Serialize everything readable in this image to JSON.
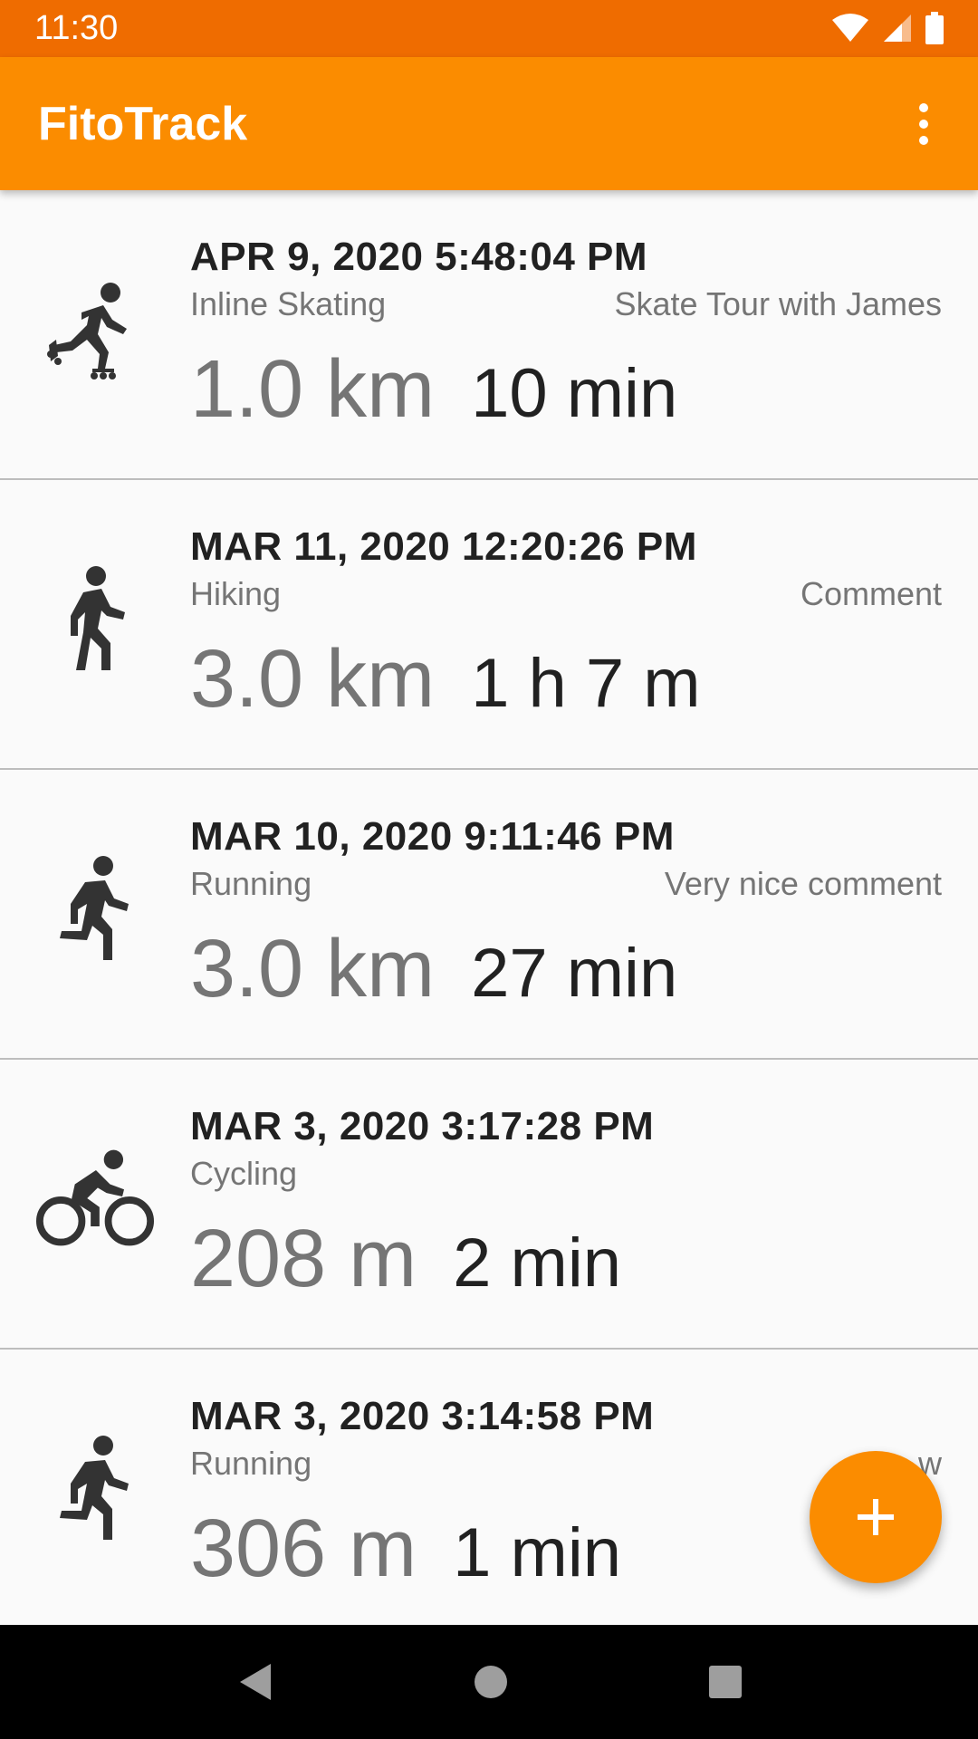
{
  "status_bar": {
    "time": "11:30"
  },
  "app_bar": {
    "title": "FitoTrack"
  },
  "workouts": [
    {
      "date": "APR 9, 2020 5:48:04 PM",
      "type": "Inline Skating",
      "comment": "Skate Tour with James",
      "distance": "1.0 km",
      "duration": "10 min",
      "icon": "inline-skating-icon"
    },
    {
      "date": "MAR 11, 2020 12:20:26 PM",
      "type": "Hiking",
      "comment": "Comment",
      "distance": "3.0 km",
      "duration": "1 h 7 m",
      "icon": "hiking-icon"
    },
    {
      "date": "MAR 10, 2020 9:11:46 PM",
      "type": "Running",
      "comment": "Very nice comment",
      "distance": "3.0 km",
      "duration": "27 min",
      "icon": "running-icon"
    },
    {
      "date": "MAR 3, 2020 3:17:28 PM",
      "type": "Cycling",
      "comment": "",
      "distance": "208 m",
      "duration": "2 min",
      "icon": "cycling-icon"
    },
    {
      "date": "MAR 3, 2020 3:14:58 PM",
      "type": "Running",
      "comment": "w",
      "distance": "306 m",
      "duration": "1 min",
      "icon": "running-icon"
    }
  ],
  "fab": {
    "icon": "plus-icon"
  },
  "colors": {
    "accent": "#fb8c00",
    "status_bar": "#ef6c00",
    "text_primary": "#212121",
    "text_secondary": "#757575"
  }
}
